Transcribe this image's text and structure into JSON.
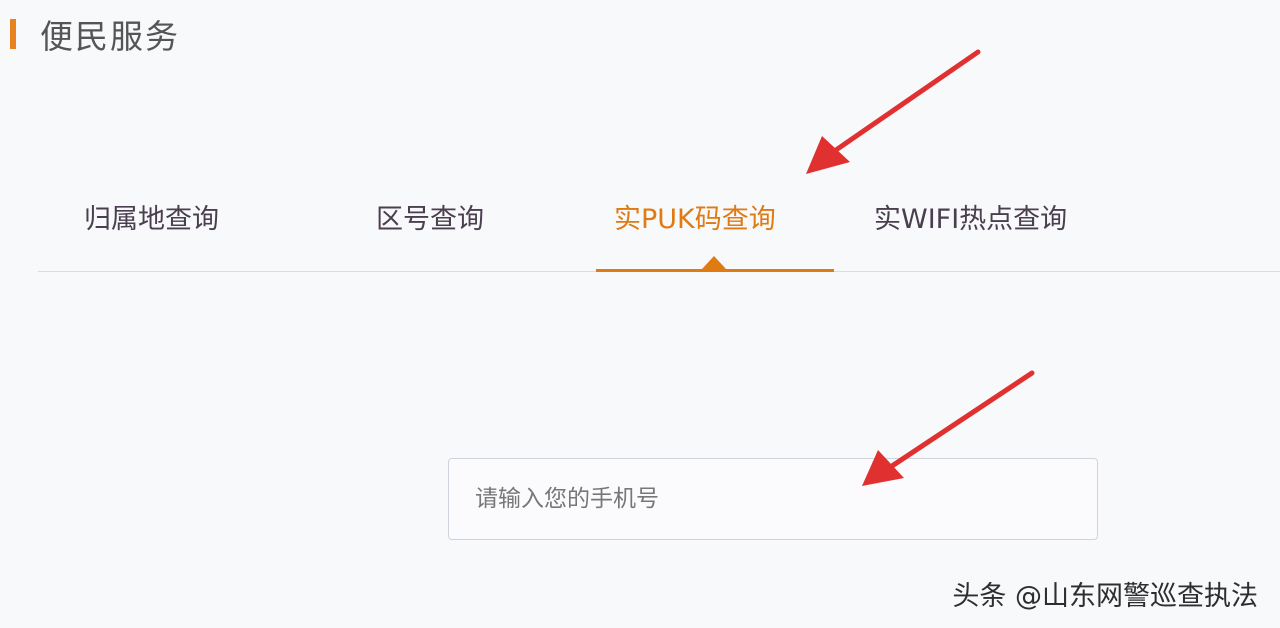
{
  "section": {
    "title": "便民服务",
    "accent_color": "#e8821f"
  },
  "tabs": [
    {
      "label": "归属地查询",
      "active": false
    },
    {
      "label": "区号查询",
      "active": false
    },
    {
      "label": "实PUK码查询",
      "active": true
    },
    {
      "label": "实WIFI热点查询",
      "active": false
    }
  ],
  "active_color": "#e07a13",
  "phone_input": {
    "placeholder": "请输入您的手机号",
    "value": ""
  },
  "annotations": {
    "arrow_color": "#e03030"
  },
  "watermark": {
    "text": "头条 @山东网警巡查执法"
  }
}
